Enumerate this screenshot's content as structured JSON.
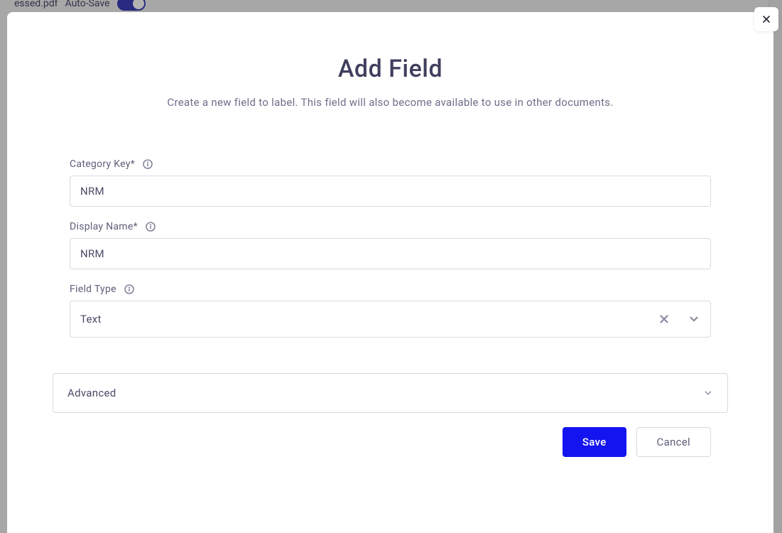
{
  "backdrop": {
    "filename_fragment": "essed.pdf",
    "autosave_label": "Auto-Save"
  },
  "modal": {
    "title": "Add Field",
    "subtitle": "Create a new field to label. This field will also become available to use in other documents.",
    "form": {
      "category_key": {
        "label": "Category Key*",
        "value": "NRM"
      },
      "display_name": {
        "label": "Display Name*",
        "value": "NRM"
      },
      "field_type": {
        "label": "Field Type",
        "value": "Text"
      }
    },
    "advanced": {
      "label": "Advanced"
    },
    "buttons": {
      "save": "Save",
      "cancel": "Cancel"
    }
  }
}
